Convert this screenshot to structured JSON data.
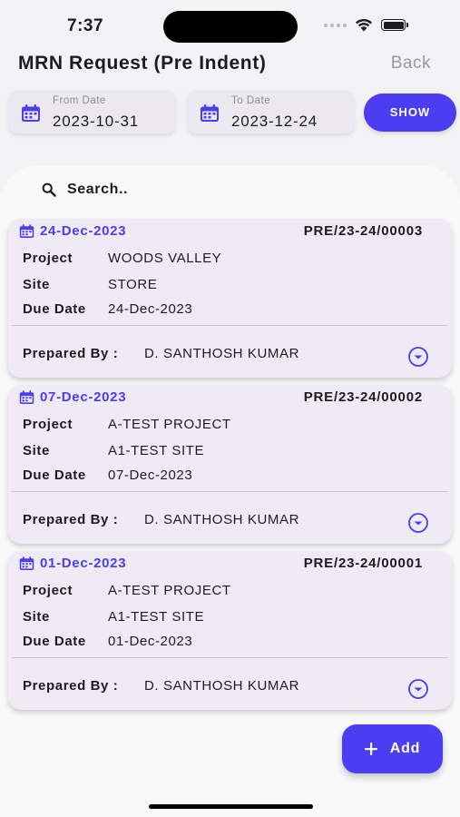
{
  "status_bar": {
    "time": "7:37"
  },
  "header": {
    "title": "MRN Request (Pre Indent)",
    "back_label": "Back"
  },
  "filters": {
    "from_label": "From Date",
    "from_value": "2023-10-31",
    "to_label": "To Date",
    "to_value": "2023-12-24",
    "show_label": "SHOW"
  },
  "search": {
    "placeholder": "Search.."
  },
  "field_labels": {
    "project": "Project",
    "site": "Site",
    "due_date": "Due Date",
    "prepared_by": "Prepared By :"
  },
  "records": [
    {
      "date": "24-Dec-2023",
      "ref": "PRE/23-24/00003",
      "project": "WOODS VALLEY",
      "site": "STORE",
      "due_date": "24-Dec-2023",
      "prepared_by": "D. SANTHOSH KUMAR"
    },
    {
      "date": "07-Dec-2023",
      "ref": "PRE/23-24/00002",
      "project": "A-TEST PROJECT",
      "site": "A1-TEST SITE",
      "due_date": "07-Dec-2023",
      "prepared_by": "D. SANTHOSH KUMAR"
    },
    {
      "date": "01-Dec-2023",
      "ref": "PRE/23-24/00001",
      "project": "A-TEST PROJECT",
      "site": "A1-TEST SITE",
      "due_date": "01-Dec-2023",
      "prepared_by": "D. SANTHOSH KUMAR"
    }
  ],
  "fab": {
    "add_label": "Add"
  },
  "icons": {
    "calendar": "calendar-icon",
    "search": "search-icon",
    "expand": "chevron-down-circle-icon",
    "add": "plus-icon",
    "wifi": "wifi-icon",
    "battery": "battery-icon",
    "signal": "signal-icon"
  },
  "colors": {
    "accent": "#4a3df2",
    "card": "#efeaf4",
    "field": "#ebe8f0",
    "muted": "#9a99a0"
  }
}
